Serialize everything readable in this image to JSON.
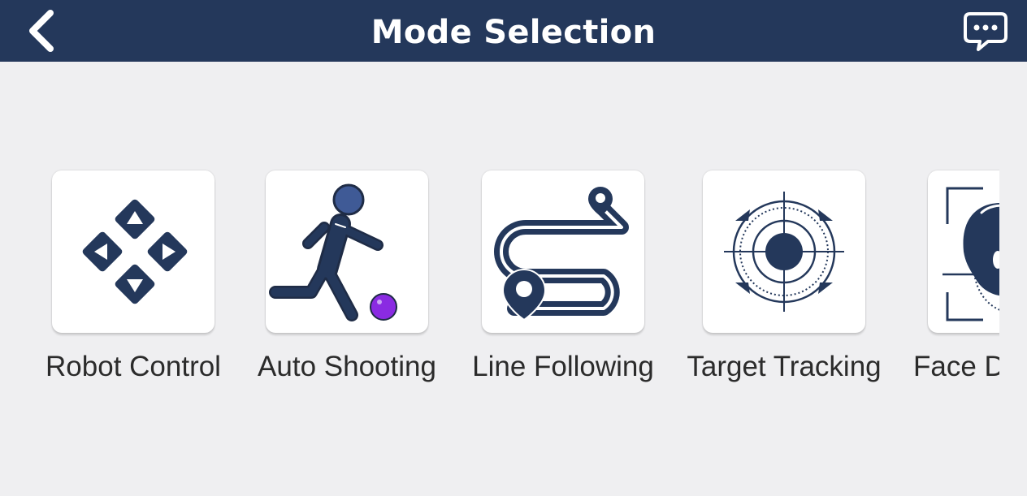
{
  "header": {
    "title": "Mode Selection",
    "back_icon": "chevron-left-icon",
    "chat_icon": "chat-bubble-icon",
    "background_color": "#24385b"
  },
  "modes": [
    {
      "label": "Robot Control",
      "icon": "direction-pad-icon"
    },
    {
      "label": "Auto Shooting",
      "icon": "soccer-player-icon"
    },
    {
      "label": "Line Following",
      "icon": "route-path-icon"
    },
    {
      "label": "Target Tracking",
      "icon": "crosshair-target-icon"
    },
    {
      "label": "Face D",
      "icon": "face-detection-icon"
    }
  ],
  "colors": {
    "icon_navy": "#24385b",
    "ball_purple": "#8a2be2",
    "background": "#efeff1"
  }
}
